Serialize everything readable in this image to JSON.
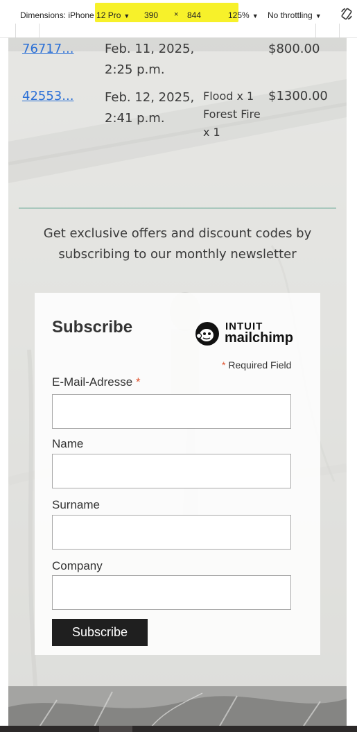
{
  "devtools": {
    "dimensions_label": "Dimensions: iPhone 12 Pro",
    "width": "390",
    "times": "×",
    "height": "844",
    "zoom": "125%",
    "throttling": "No throttling",
    "caret": "▼",
    "highlight_color": "#f7f12a",
    "rotate_icon": "rotate-icon"
  },
  "orders": [
    {
      "id": "76717...",
      "date": "Feb. 11, 2025, 2:25 p.m.",
      "items": "",
      "total": "$800.00"
    },
    {
      "id": "42553...",
      "date": "Feb. 12, 2025, 2:41 p.m.",
      "items": "Flood x 1 Forest Fire x 1",
      "total": "$1300.00"
    }
  ],
  "newsletter": {
    "promo": "Get exclusive offers and discount codes by subscribing to our monthly newsletter",
    "divider_color": "#a9c8bd"
  },
  "form": {
    "title": "Subscribe",
    "logo_top": "INTUIT",
    "logo_bottom": "mailchimp",
    "required_note": "Required Field",
    "asterisk": "*",
    "asterisk_color": "#e0522e",
    "fields": [
      {
        "label": "E-Mail-Adresse",
        "required": true,
        "value": ""
      },
      {
        "label": "Name",
        "required": false,
        "value": ""
      },
      {
        "label": "Surname",
        "required": false,
        "value": ""
      },
      {
        "label": "Company",
        "required": false,
        "value": ""
      }
    ],
    "submit_label": "Subscribe"
  }
}
